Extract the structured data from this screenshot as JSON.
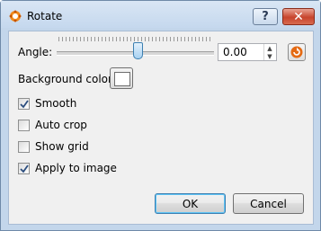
{
  "window": {
    "title": "Rotate",
    "help_label": "?",
    "close_label": "✕"
  },
  "angle": {
    "label": "Angle:",
    "value": "0.00",
    "slider_level": 0.5
  },
  "background": {
    "label": "Background color",
    "color": "#ffffff"
  },
  "options": [
    {
      "label": "Smooth",
      "checked": true
    },
    {
      "label": "Auto crop",
      "checked": false
    },
    {
      "label": "Show grid",
      "checked": false
    },
    {
      "label": "Apply to image",
      "checked": true
    }
  ],
  "buttons": {
    "ok": "OK",
    "cancel": "Cancel"
  },
  "colors": {
    "accent": "#3c7fb1",
    "reset_icon": "#e46a13"
  },
  "icons": {
    "app": "rotate-app-icon",
    "reset": "reset-rotation-icon"
  }
}
